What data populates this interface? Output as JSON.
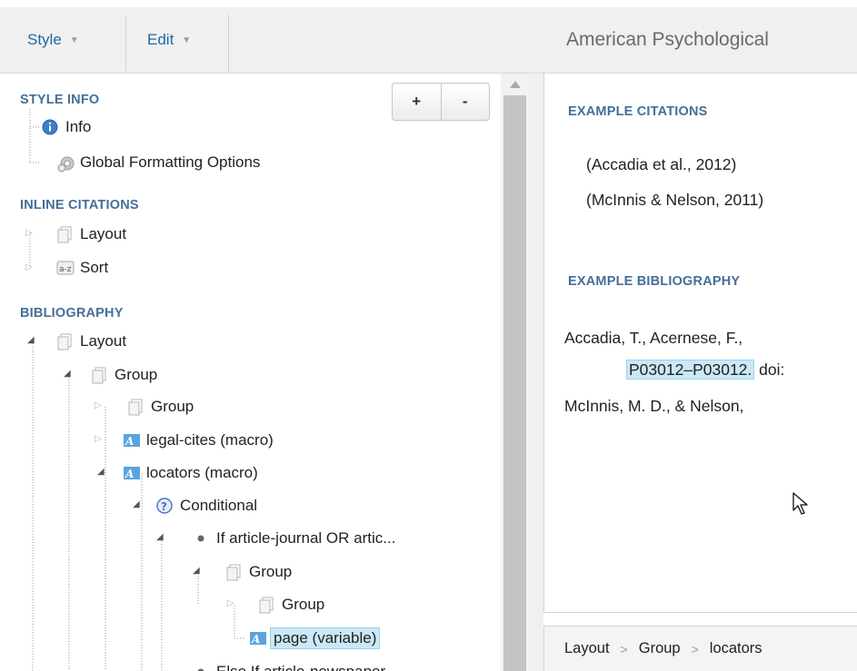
{
  "menu": {
    "style_label": "Style",
    "edit_label": "Edit",
    "style_title": "American Psychological"
  },
  "tree": {
    "zoom_in": "+",
    "zoom_out": "-",
    "style_info_heading": "STYLE INFO",
    "info_label": "Info",
    "global_label": "Global Formatting Options",
    "inline_heading": "INLINE CITATIONS",
    "inline_layout": "Layout",
    "inline_sort": "Sort",
    "bibliography_heading": "BIBLIOGRAPHY",
    "bib_layout": "Layout",
    "bib_group": "Group",
    "bib_group_inner": "Group",
    "legal_cites": "legal-cites (macro)",
    "locators": "locators (macro)",
    "conditional": "Conditional",
    "if_article": "If article-journal OR artic...",
    "if_group": "Group",
    "if_group_inner": "Group",
    "page_variable": "page (variable)",
    "else_if": "Else If article-newspaper"
  },
  "preview": {
    "citations_heading": "EXAMPLE CITATIONS",
    "citation_1": "(Accadia et al., 2012)",
    "citation_2": "(McInnis & Nelson, 2011)",
    "bibliography_heading": "EXAMPLE BIBLIOGRAPHY",
    "bib_1_line1": "Accadia, T., Acernese, F., ",
    "bib_1_pages": "P03012–P03012.",
    "bib_1_doi": " doi:",
    "bib_2": "McInnis, M. D., & Nelson,"
  },
  "breadcrumb": {
    "items": [
      "Layout",
      "Group",
      "locators"
    ],
    "separator": ">"
  },
  "icons": {
    "info": "info-icon",
    "gear": "gear-icon",
    "layout": "pages-icon",
    "sort": "sort-az-icon",
    "macro": "macro-icon",
    "conditional": "question-icon",
    "bullet": "bullet-icon"
  },
  "colors": {
    "link": "#1b6aa5",
    "heading": "#456f98",
    "selection": "#cbe8f6"
  }
}
